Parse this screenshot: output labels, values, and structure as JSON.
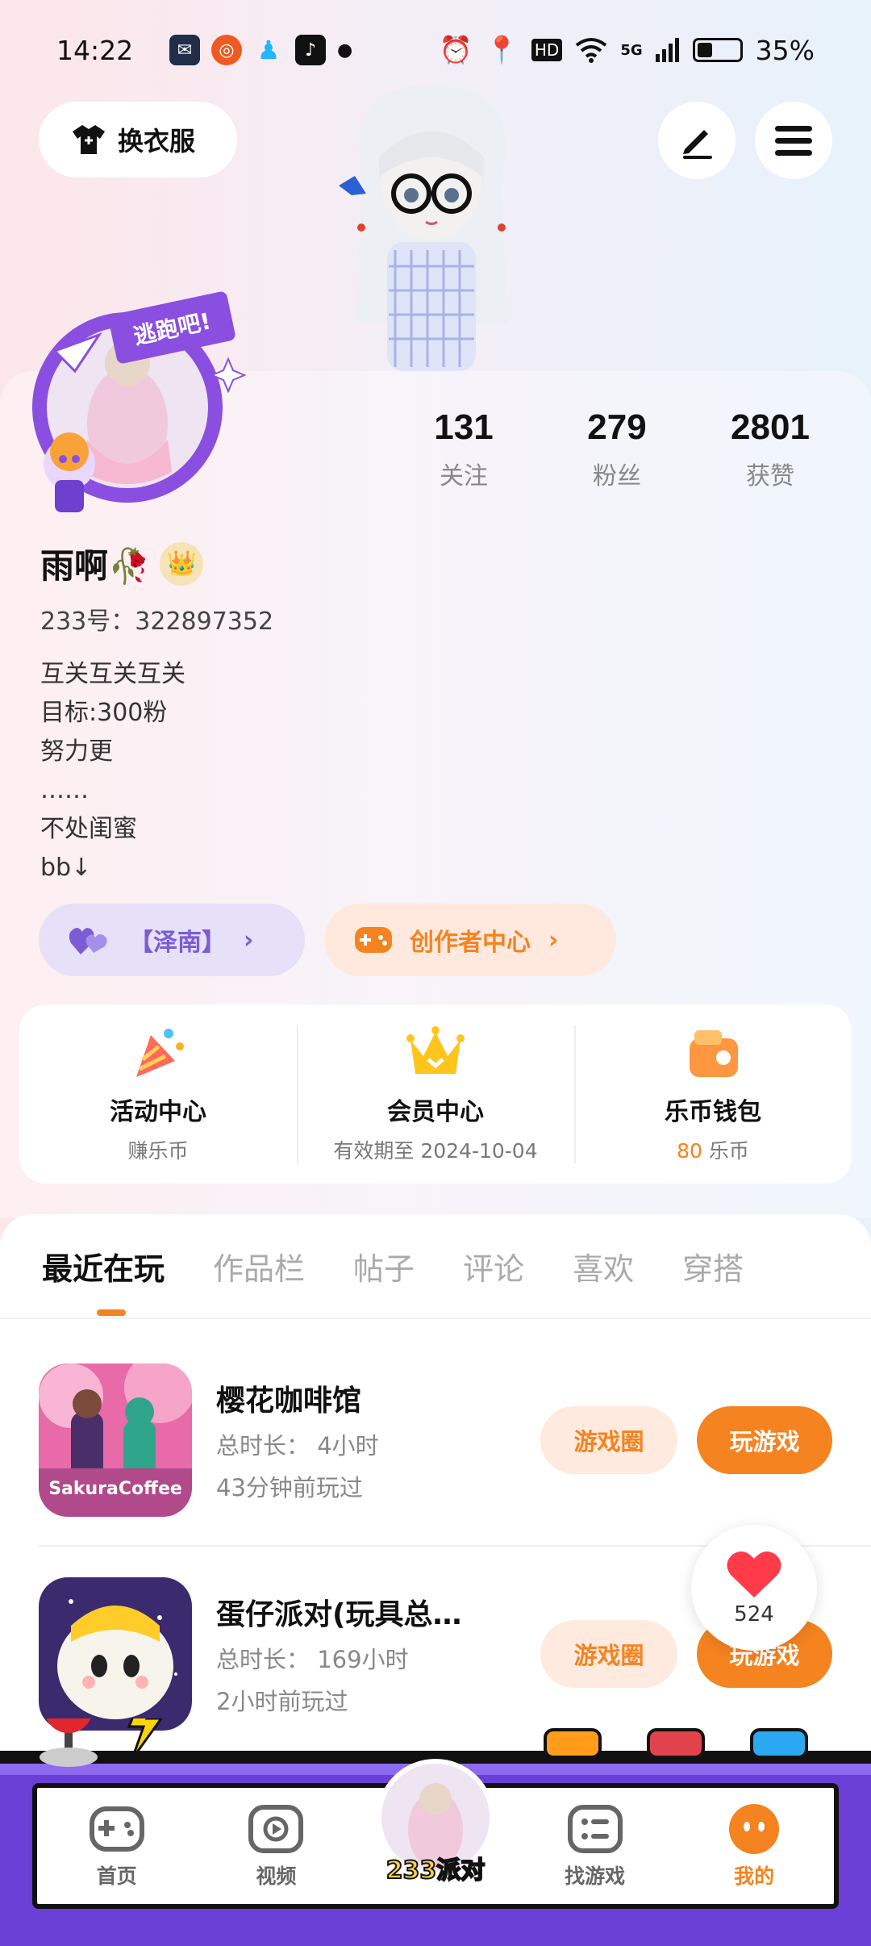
{
  "status": {
    "time": "14:22",
    "battery_percent": "35%",
    "battery_level": 0.35,
    "hd": "HD",
    "network": "5G"
  },
  "header": {
    "outfit_label": "换衣服"
  },
  "profile": {
    "stats": [
      {
        "value": "131",
        "label": "关注"
      },
      {
        "value": "279",
        "label": "粉丝"
      },
      {
        "value": "2801",
        "label": "获赞"
      }
    ],
    "nickname": "雨啊🥀",
    "uid_label": "233号：",
    "uid_value": "322897352",
    "bio_lines": [
      "互关互关互关",
      "目标:300粉",
      "努力更",
      "……",
      "不处闺蜜",
      "bb↓"
    ],
    "avatar_badge": "逃跑吧!"
  },
  "tags": {
    "group_label": "【泽南】",
    "creator_label": "创作者中心"
  },
  "quick": [
    {
      "title": "活动中心",
      "sub": "赚乐币"
    },
    {
      "title": "会员中心",
      "sub": "有效期至 2024-10-04"
    },
    {
      "title": "乐币钱包",
      "coins": "80",
      "sub": "乐币"
    }
  ],
  "tabs": [
    "最近在玩",
    "作品栏",
    "帖子",
    "评论",
    "喜欢",
    "穿搭"
  ],
  "games": [
    {
      "title": "樱花咖啡馆",
      "duration": "总时长： 4小时",
      "last_played": "43分钟前玩过",
      "thumb_text": "SakuraCoffee",
      "circle_label": "游戏圈",
      "play_label": "玩游戏"
    },
    {
      "title": "蛋仔派对(玩具总…",
      "duration": "总时长： 169小时",
      "last_played": "2小时前玩过",
      "circle_label": "游戏圈",
      "play_label": "玩游戏"
    }
  ],
  "like_count": "524",
  "nav": {
    "home": "首页",
    "video": "视频",
    "center": "233派对",
    "find": "找游戏",
    "me": "我的"
  },
  "colors": {
    "accent": "#f5831f",
    "purple": "#7b5cd6",
    "nav_frame": "#6a3fd6"
  }
}
